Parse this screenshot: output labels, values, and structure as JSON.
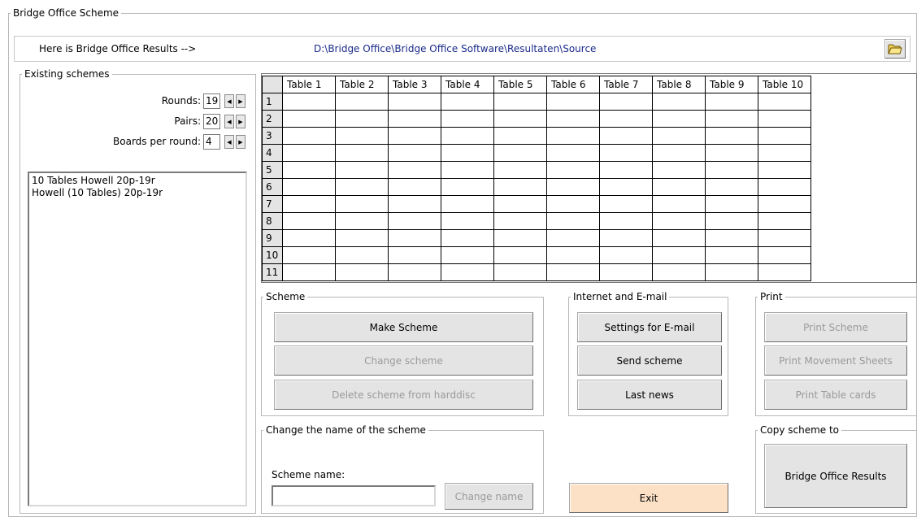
{
  "window": {
    "title": "Bridge Office Scheme"
  },
  "path_row": {
    "label": "Here is Bridge Office Results -->",
    "path": "D:\\Bridge Office\\Bridge Office Software\\Resultaten\\Source"
  },
  "existing": {
    "title": "Existing schemes",
    "rounds_label": "Rounds:",
    "rounds_value": "19",
    "pairs_label": "Pairs:",
    "pairs_value": "20",
    "boards_label": "Boards per round:",
    "boards_value": "4",
    "schemes": [
      "10 Tables Howell 20p-19r",
      "Howell (10 Tables) 20p-19r"
    ]
  },
  "grid": {
    "columns": [
      "Table 1",
      "Table 2",
      "Table 3",
      "Table 4",
      "Table 5",
      "Table 6",
      "Table 7",
      "Table 8",
      "Table 9",
      "Table 10"
    ],
    "rows": [
      "1",
      "2",
      "3",
      "4",
      "5",
      "6",
      "7",
      "8",
      "9",
      "10",
      "11"
    ]
  },
  "scheme_group": {
    "title": "Scheme",
    "make": "Make Scheme",
    "change": "Change scheme",
    "delete": "Delete scheme from harddisc"
  },
  "internet_group": {
    "title": "Internet and E-mail",
    "settings": "Settings for E-mail",
    "send": "Send scheme",
    "news": "Last news"
  },
  "print_group": {
    "title": "Print",
    "scheme": "Print Scheme",
    "movement": "Print Movement Sheets",
    "cards": "Print Table cards"
  },
  "rename_group": {
    "title": "Change the name of the scheme",
    "field_label": "Scheme name:",
    "field_value": "",
    "button": "Change name"
  },
  "copy_group": {
    "title": "Copy scheme to",
    "button": "Bridge Office Results"
  },
  "exit": {
    "label": "Exit"
  }
}
